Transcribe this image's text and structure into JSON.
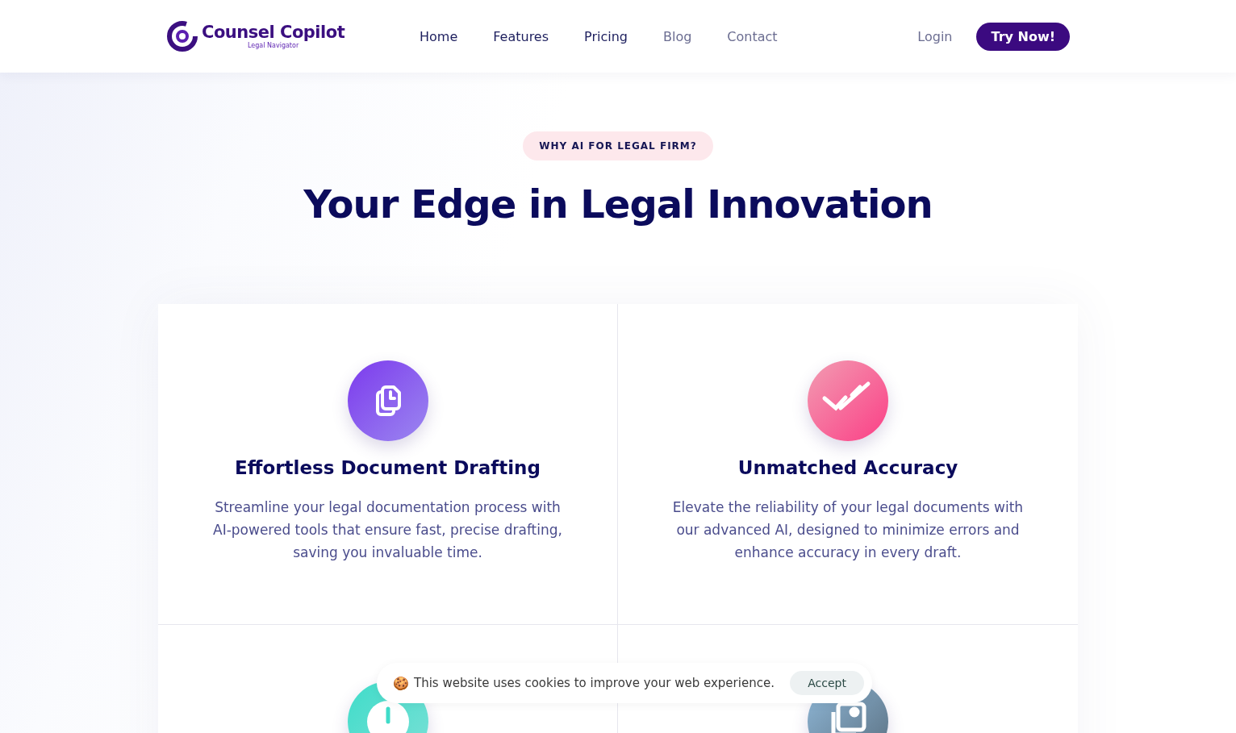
{
  "brand": {
    "name": "Counsel Copilot",
    "tagline": "Legal Navigator"
  },
  "nav": [
    {
      "label": "Home",
      "muted": false
    },
    {
      "label": "Features",
      "muted": false
    },
    {
      "label": "Pricing",
      "muted": false
    },
    {
      "label": "Blog",
      "muted": true
    },
    {
      "label": "Contact",
      "muted": true
    }
  ],
  "login": "Login",
  "cta": "Try Now!",
  "badge": "WHY AI FOR LEGAL FIRM?",
  "heading": "Your Edge in Legal Innovation",
  "features": [
    {
      "kind": "document",
      "title": "Effortless Document Drafting",
      "text": "Streamline your legal documentation process with AI-powered tools that ensure fast, precise drafting, saving you invaluable time."
    },
    {
      "kind": "check",
      "title": "Unmatched Accuracy",
      "text": "Elevate the reliability of your legal documents with our advanced AI, designed to minimize errors and enhance accuracy in every draft."
    },
    {
      "kind": "clock"
    },
    {
      "kind": "image"
    }
  ],
  "cookie": {
    "icon": "🍪",
    "text": "This website uses cookies to improve your web experience.",
    "button": "Accept"
  }
}
